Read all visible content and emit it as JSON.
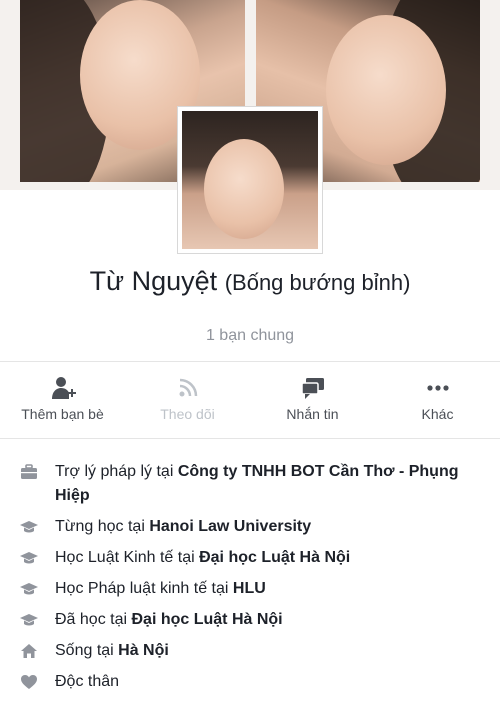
{
  "profile": {
    "name": "Từ Nguyệt",
    "alternate_name": "(Bống bướng bỉnh)",
    "mutual_friends": "1 bạn chung"
  },
  "actions": [
    {
      "label": "Thêm bạn bè",
      "icon": "add-friend-icon",
      "enabled": true
    },
    {
      "label": "Theo dõi",
      "icon": "follow-rss-icon",
      "enabled": false
    },
    {
      "label": "Nhắn tin",
      "icon": "message-icon",
      "enabled": true
    },
    {
      "label": "Khác",
      "icon": "more-dots-icon",
      "enabled": true
    }
  ],
  "about": [
    {
      "icon": "briefcase-icon",
      "prefix": "Trợ lý pháp lý tại ",
      "bold": "Công ty TNHH BOT Cần Thơ - Phụng Hiệp"
    },
    {
      "icon": "graduation-cap-icon",
      "prefix": "Từng học tại ",
      "bold": "Hanoi Law University"
    },
    {
      "icon": "graduation-cap-icon",
      "prefix": "Học Luật Kinh tế tại ",
      "bold": "Đại học Luật Hà Nội"
    },
    {
      "icon": "graduation-cap-icon",
      "prefix": "Học Pháp luật kinh tế tại ",
      "bold": "HLU"
    },
    {
      "icon": "graduation-cap-icon",
      "prefix": "Đã học tại ",
      "bold": "Đại học Luật Hà Nội"
    },
    {
      "icon": "home-icon",
      "prefix": "Sống tại ",
      "bold": "Hà Nội"
    },
    {
      "icon": "heart-icon",
      "prefix": "Độc thân",
      "bold": ""
    }
  ],
  "colors": {
    "icon_gray": "#90949c",
    "text": "#1d2129",
    "disabled": "#bec3c9"
  }
}
